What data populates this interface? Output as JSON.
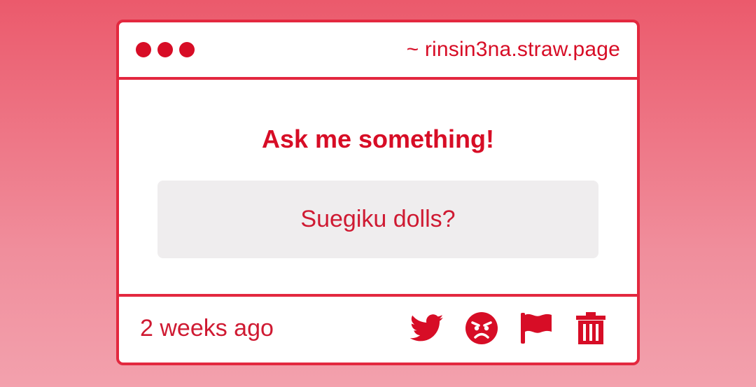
{
  "window": {
    "url": "~ rinsin3na.straw.page",
    "dots": [
      "dot-1",
      "dot-2",
      "dot-3"
    ]
  },
  "content": {
    "heading": "Ask me something!",
    "question": "Suegiku dolls?"
  },
  "footer": {
    "timestamp": "2 weeks ago",
    "actions": [
      {
        "name": "twitter-share",
        "icon": "twitter-bird-icon"
      },
      {
        "name": "angry-react",
        "icon": "angry-face-icon"
      },
      {
        "name": "report",
        "icon": "flag-icon"
      },
      {
        "name": "delete",
        "icon": "trash-icon"
      }
    ]
  },
  "colors": {
    "accent": "#d70d26",
    "border": "#e3283f",
    "question_bg": "#efedee",
    "background_top": "#eb5a6c",
    "background_bottom": "#f3a1ad"
  }
}
